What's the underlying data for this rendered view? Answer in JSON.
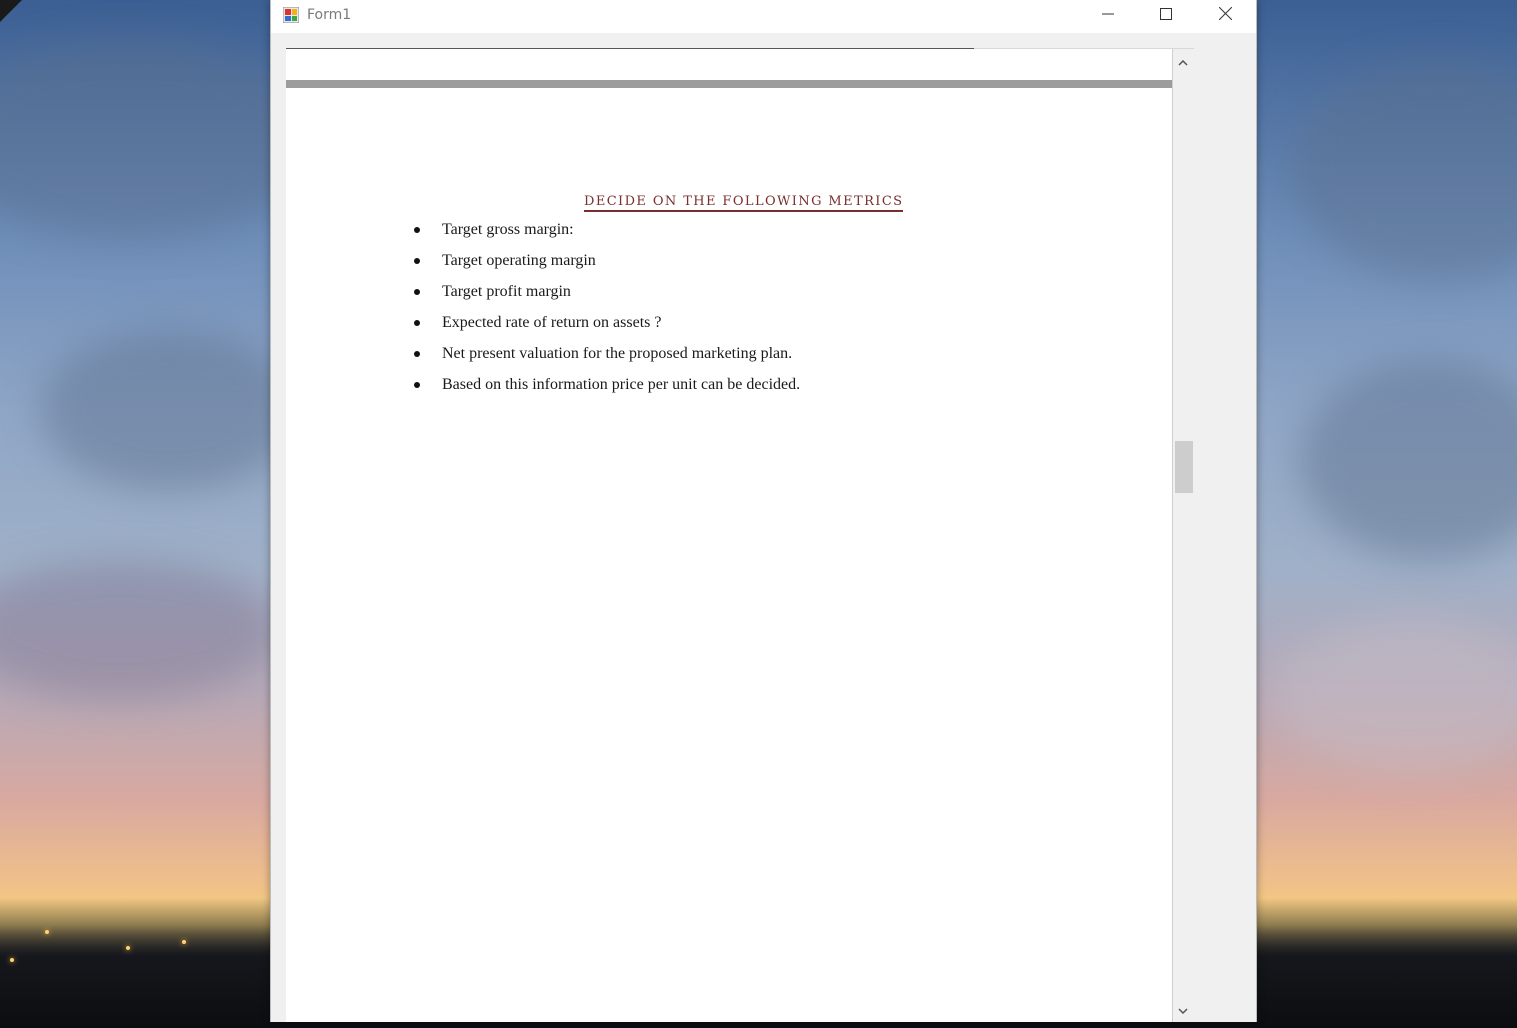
{
  "window": {
    "title": "Form1"
  },
  "document": {
    "heading": "DECIDE ON THE FOLLOWING METRICS",
    "bullets": [
      "Target gross margin:",
      "Target operating margin",
      "Target profit margin",
      "Expected rate of return on assets ?",
      "Net present valuation for the proposed marketing plan.",
      "Based on this information price per unit can be decided."
    ]
  },
  "icons": {
    "app": "form-app-icon",
    "minimize": "minimize-icon",
    "maximize": "maximize-icon",
    "close": "close-icon",
    "scroll_up": "chevron-up-icon",
    "scroll_down": "chevron-down-icon"
  },
  "colors": {
    "heading": "#7a2e2e",
    "titlebar": "#ffffff",
    "window_frame": "#f0f0f0"
  }
}
